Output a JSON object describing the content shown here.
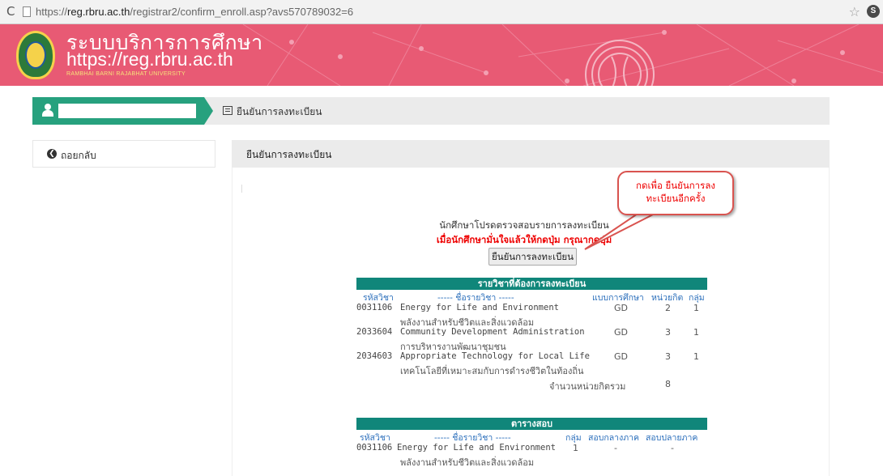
{
  "browser": {
    "url_prefix": "https://",
    "url_host": "reg.rbru.ac.th",
    "url_path": "/registrar2/confirm_enroll.asp?avs570789032=6",
    "reload_glyph": "C",
    "star_glyph": "☆",
    "ext_label": "S"
  },
  "header": {
    "title": "ระบบบริการการศึกษา",
    "url": "https://reg.rbru.ac.th",
    "subtitle": "RAMBHAI BARNI RAJABHAT UNIVERSITY",
    "colors": {
      "background": "#e85a74",
      "accent": "#f6e27a"
    }
  },
  "breadcrumb": {
    "user_name": "",
    "current": "ยืนยันการลงทะเบียน"
  },
  "sidebar": {
    "back_label": "ถอยกลับ",
    "back_icon": "arrow-left-circle-icon"
  },
  "panel": {
    "title": "ยืนยันการลงทะเบียน",
    "notice_line1": "นักศึกษาโปรดตรวจสอบรายการลงทะเบียน",
    "notice_line2": "เมื่อนักศึกษามั่นใจแล้วให้กดปุ่ม กรุณากดปุ่ม",
    "confirm_button": "ยืนยันการลงทะเบียน"
  },
  "callout": {
    "line1": "กดเพื่อ ยืนยันการลง",
    "line2": "ทะเบียนอีกครั้ง",
    "color": "#e00000"
  },
  "enroll_table": {
    "title": "รายวิชาที่ต้องการลงทะเบียน",
    "columns": {
      "code": "รหัสวิชา",
      "name": "----- ชื่อรายวิชา -----",
      "type": "แบบการศึกษา",
      "credits": "หน่วยกิต",
      "group": "กลุ่ม"
    },
    "rows": [
      {
        "code": "0031106",
        "name_en": "Energy for Life and Environment",
        "name_th": "พลังงานสำหรับชีวิตและสิ่งแวดล้อม",
        "type": "GD",
        "credits": "2",
        "group": "1"
      },
      {
        "code": "2033604",
        "name_en": "Community Development Administration",
        "name_th": "การบริหารงานพัฒนาชุมชน",
        "type": "GD",
        "credits": "3",
        "group": "1"
      },
      {
        "code": "2034603",
        "name_en": "Appropriate Technology for Local Life",
        "name_th": "เทคโนโลยีที่เหมาะสมกับการดำรงชีวิตในท้องถิ่น",
        "type": "GD",
        "credits": "3",
        "group": "1"
      }
    ],
    "total_label": "จำนวนหน่วยกิตรวม",
    "total_value": "8"
  },
  "exam_table": {
    "title": "ตารางสอบ",
    "columns": {
      "code": "รหัสวิชา",
      "name": "----- ชื่อรายวิชา -----",
      "group": "กลุ่ม",
      "midterm": "สอบกลางภาค",
      "final": "สอบปลายภาค"
    },
    "rows": [
      {
        "code": "0031106",
        "name_en": "Energy for Life and Environment",
        "name_th": "พลังงานสำหรับชีวิตและสิ่งแวดล้อม",
        "group": "1",
        "midterm": "-",
        "final": "-"
      }
    ]
  }
}
